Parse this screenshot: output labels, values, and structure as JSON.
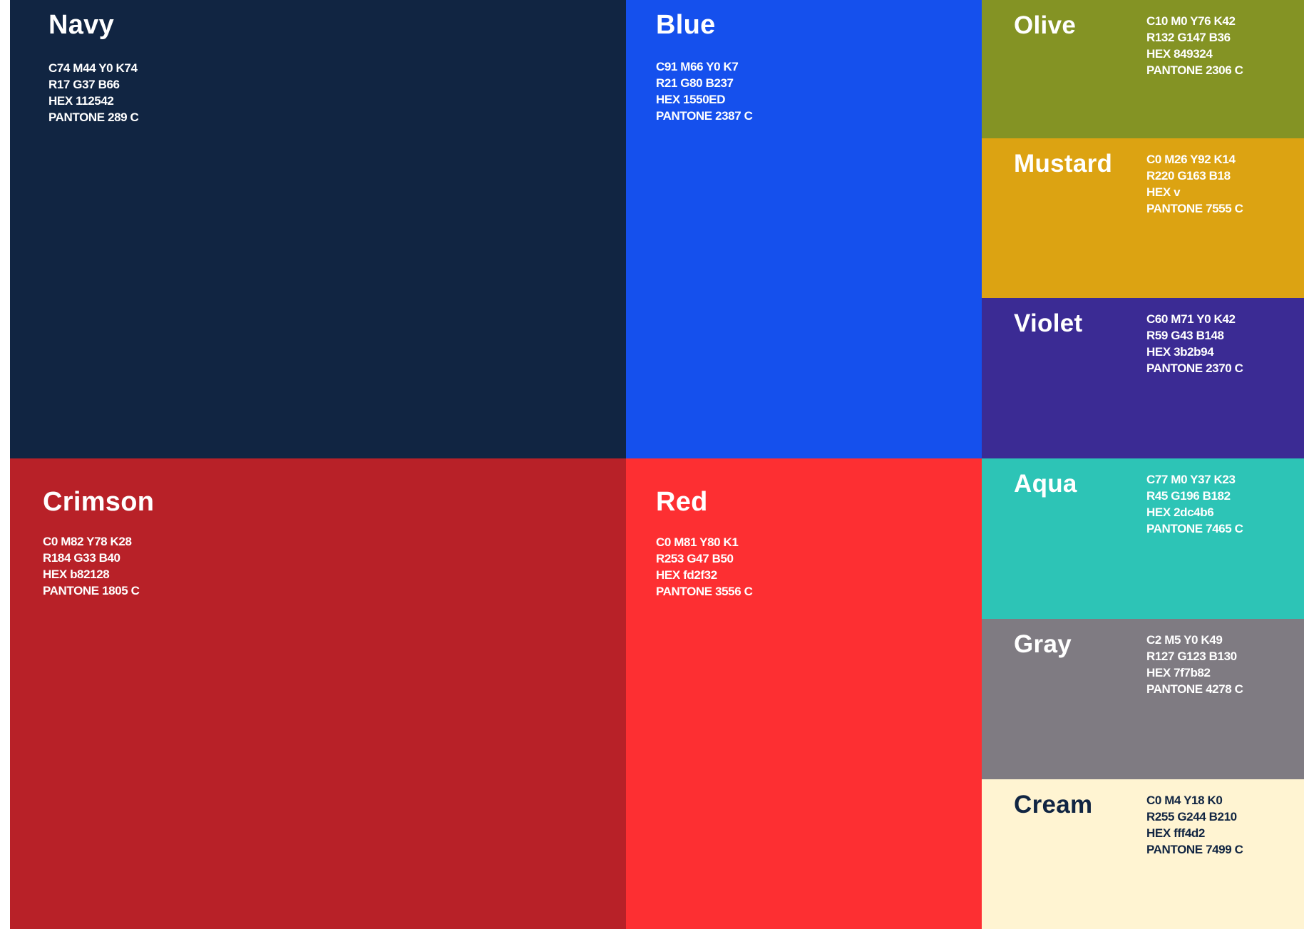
{
  "swatches": {
    "navy": {
      "name": "Navy",
      "cmyk": "C74 M44 Y0 K74",
      "rgb": "R17 G37 B66",
      "hex": "HEX 112542",
      "pantone": "PANTONE 289 C",
      "color": "#112542",
      "text_color": "#ffffff"
    },
    "blue": {
      "name": "Blue",
      "cmyk": "C91 M66 Y0 K7",
      "rgb": "R21 G80 B237",
      "hex": "HEX 1550ED",
      "pantone": "PANTONE 2387 C",
      "color": "#1550ed",
      "text_color": "#ffffff"
    },
    "olive": {
      "name": "Olive",
      "cmyk": "C10 M0 Y76 K42",
      "rgb": "R132 G147 B36",
      "hex": "HEX 849324",
      "pantone": "PANTONE 2306 C",
      "color": "#849324",
      "text_color": "#ffffff"
    },
    "mustard": {
      "name": "Mustard",
      "cmyk": "C0 M26 Y92 K14",
      "rgb": "R220 G163 B18",
      "hex": "HEX v",
      "pantone": "PANTONE 7555 C",
      "color": "#dca312",
      "text_color": "#ffffff"
    },
    "violet": {
      "name": "Violet",
      "cmyk": "C60 M71 Y0 K42",
      "rgb": "R59 G43 B148",
      "hex": "HEX 3b2b94",
      "pantone": "PANTONE 2370 C",
      "color": "#3b2b94",
      "text_color": "#ffffff"
    },
    "crimson": {
      "name": "Crimson",
      "cmyk": "C0 M82 Y78 K28",
      "rgb": "R184 G33 B40",
      "hex": "HEX b82128",
      "pantone": "PANTONE 1805 C",
      "color": "#b82128",
      "text_color": "#ffffff"
    },
    "red": {
      "name": "Red",
      "cmyk": "C0 M81 Y80 K1",
      "rgb": "R253 G47 B50",
      "hex": "HEX fd2f32",
      "pantone": "PANTONE 3556 C",
      "color": "#fd2f32",
      "text_color": "#ffffff"
    },
    "aqua": {
      "name": "Aqua",
      "cmyk": "C77 M0 Y37 K23",
      "rgb": "R45 G196 B182",
      "hex": "HEX 2dc4b6",
      "pantone": "PANTONE 7465 C",
      "color": "#2dc4b6",
      "text_color": "#ffffff"
    },
    "gray": {
      "name": "Gray",
      "cmyk": "C2 M5 Y0 K49",
      "rgb": "R127 G123 B130",
      "hex": "HEX 7f7b82",
      "pantone": "PANTONE 4278 C",
      "color": "#7f7b82",
      "text_color": "#ffffff"
    },
    "cream": {
      "name": "Cream",
      "cmyk": "C0 M4 Y18 K0",
      "rgb": "R255 G244 B210",
      "hex": "HEX fff4d2",
      "pantone": "PANTONE 7499 C",
      "color": "#fff4d2",
      "text_color": "#112542"
    }
  }
}
